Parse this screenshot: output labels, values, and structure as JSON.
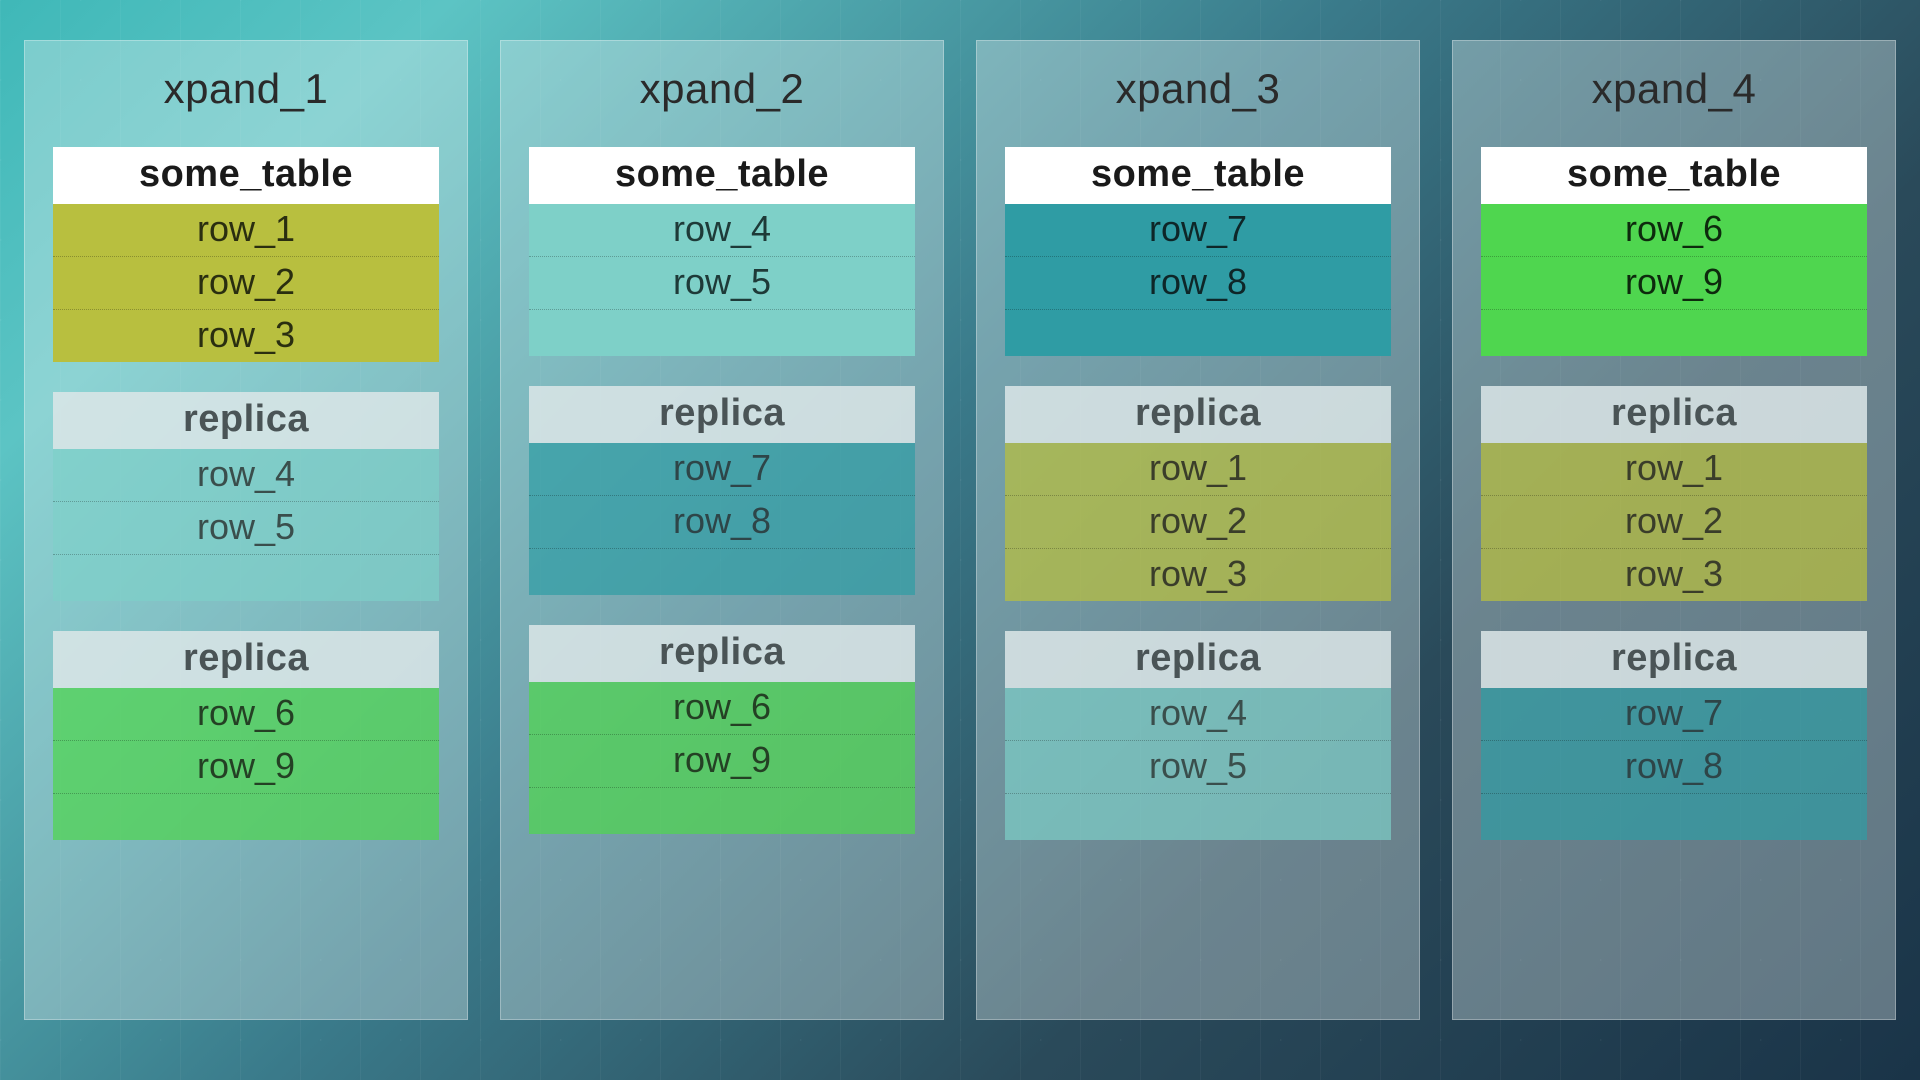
{
  "labels": {
    "primary_header": "some_table",
    "replica_header": "replica"
  },
  "shard_colors": {
    "A": "olive",
    "B": "aqua",
    "C": "teal",
    "D": "green"
  },
  "nodes": [
    {
      "name": "xpand_1",
      "primary": {
        "shard": "A",
        "rows": [
          "row_1",
          "row_2",
          "row_3"
        ],
        "pad": 0
      },
      "replicas": [
        {
          "shard": "B",
          "rows": [
            "row_4",
            "row_5"
          ],
          "pad": 1
        },
        {
          "shard": "D",
          "rows": [
            "row_6",
            "row_9"
          ],
          "pad": 1
        }
      ]
    },
    {
      "name": "xpand_2",
      "primary": {
        "shard": "B",
        "rows": [
          "row_4",
          "row_5"
        ],
        "pad": 1
      },
      "replicas": [
        {
          "shard": "C",
          "rows": [
            "row_7",
            "row_8"
          ],
          "pad": 1
        },
        {
          "shard": "D",
          "rows": [
            "row_6",
            "row_9"
          ],
          "pad": 1
        }
      ]
    },
    {
      "name": "xpand_3",
      "primary": {
        "shard": "C",
        "rows": [
          "row_7",
          "row_8"
        ],
        "pad": 1
      },
      "replicas": [
        {
          "shard": "A",
          "rows": [
            "row_1",
            "row_2",
            "row_3"
          ],
          "pad": 0
        },
        {
          "shard": "B",
          "rows": [
            "row_4",
            "row_5"
          ],
          "pad": 1
        }
      ]
    },
    {
      "name": "xpand_4",
      "primary": {
        "shard": "D",
        "rows": [
          "row_6",
          "row_9"
        ],
        "pad": 1
      },
      "replicas": [
        {
          "shard": "A",
          "rows": [
            "row_1",
            "row_2",
            "row_3"
          ],
          "pad": 0
        },
        {
          "shard": "C",
          "rows": [
            "row_7",
            "row_8"
          ],
          "pad": 1
        }
      ]
    }
  ]
}
